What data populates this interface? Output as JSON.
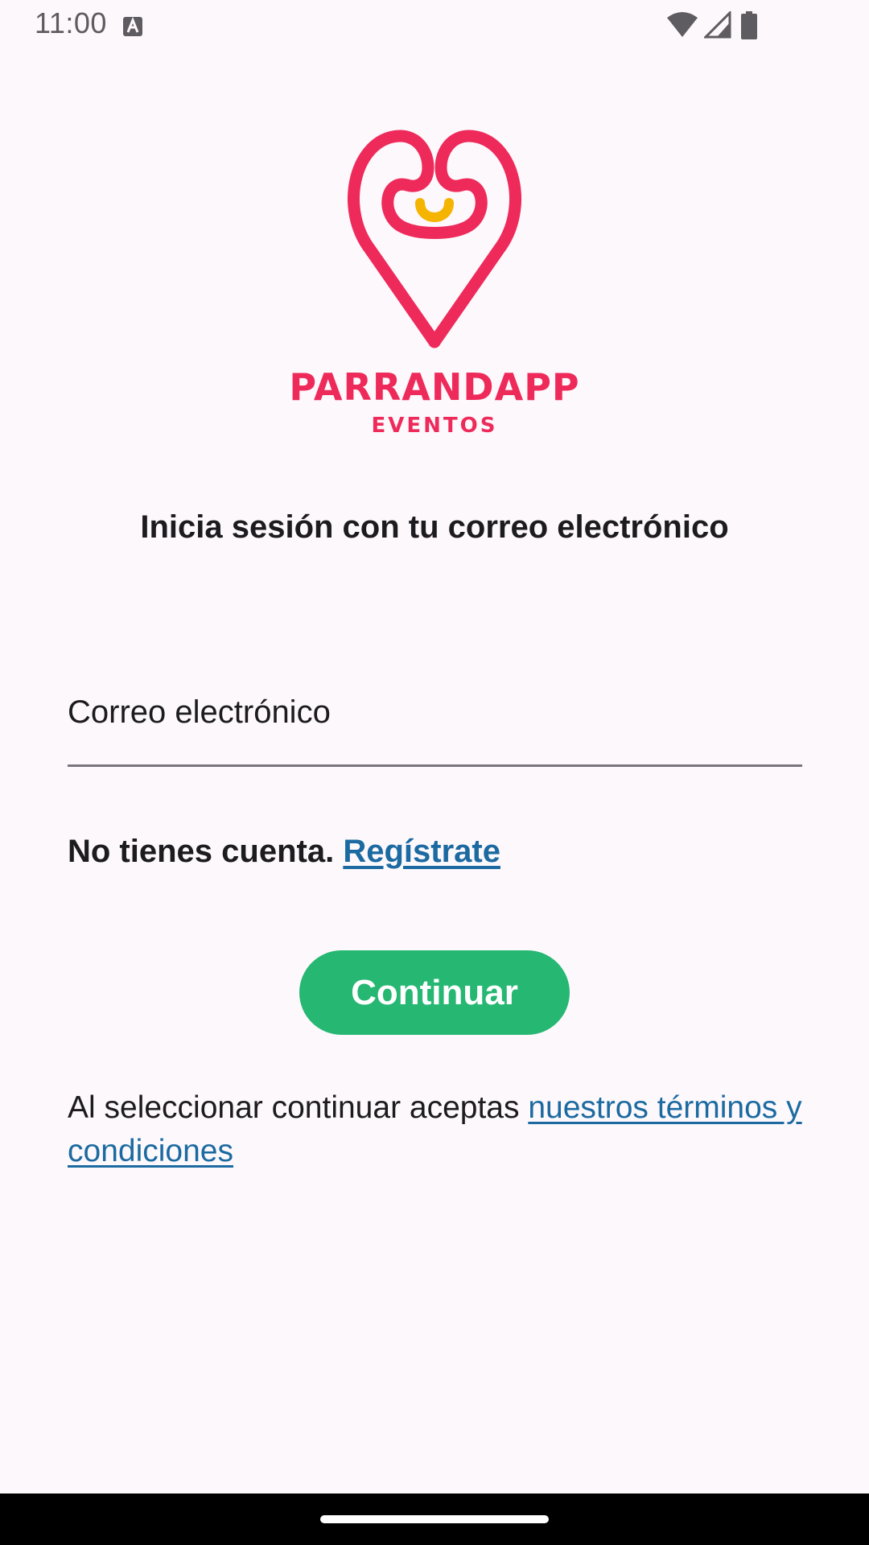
{
  "status_bar": {
    "time": "11:00",
    "icons": [
      "text-a-notification-icon",
      "wifi-icon",
      "signal-icon",
      "battery-icon"
    ]
  },
  "logo": {
    "brand": "PARRANDAPP",
    "subtitle": "EVENTOS",
    "colors": {
      "primary": "#ee2a5b",
      "accent": "#f5b400"
    }
  },
  "login": {
    "heading": "Inicia sesión con tu correo electrónico",
    "email_placeholder": "Correo electrónico",
    "email_value": "",
    "no_account_text": "No tienes cuenta.",
    "register_link": "Regístrate",
    "continue_label": "Continuar",
    "terms_prefix": "Al seleccionar continuar aceptas ",
    "terms_link": "nuestros términos y condiciones"
  },
  "colors": {
    "background": "#fdf8fb",
    "button": "#26b773",
    "link": "#1b6aa1"
  }
}
